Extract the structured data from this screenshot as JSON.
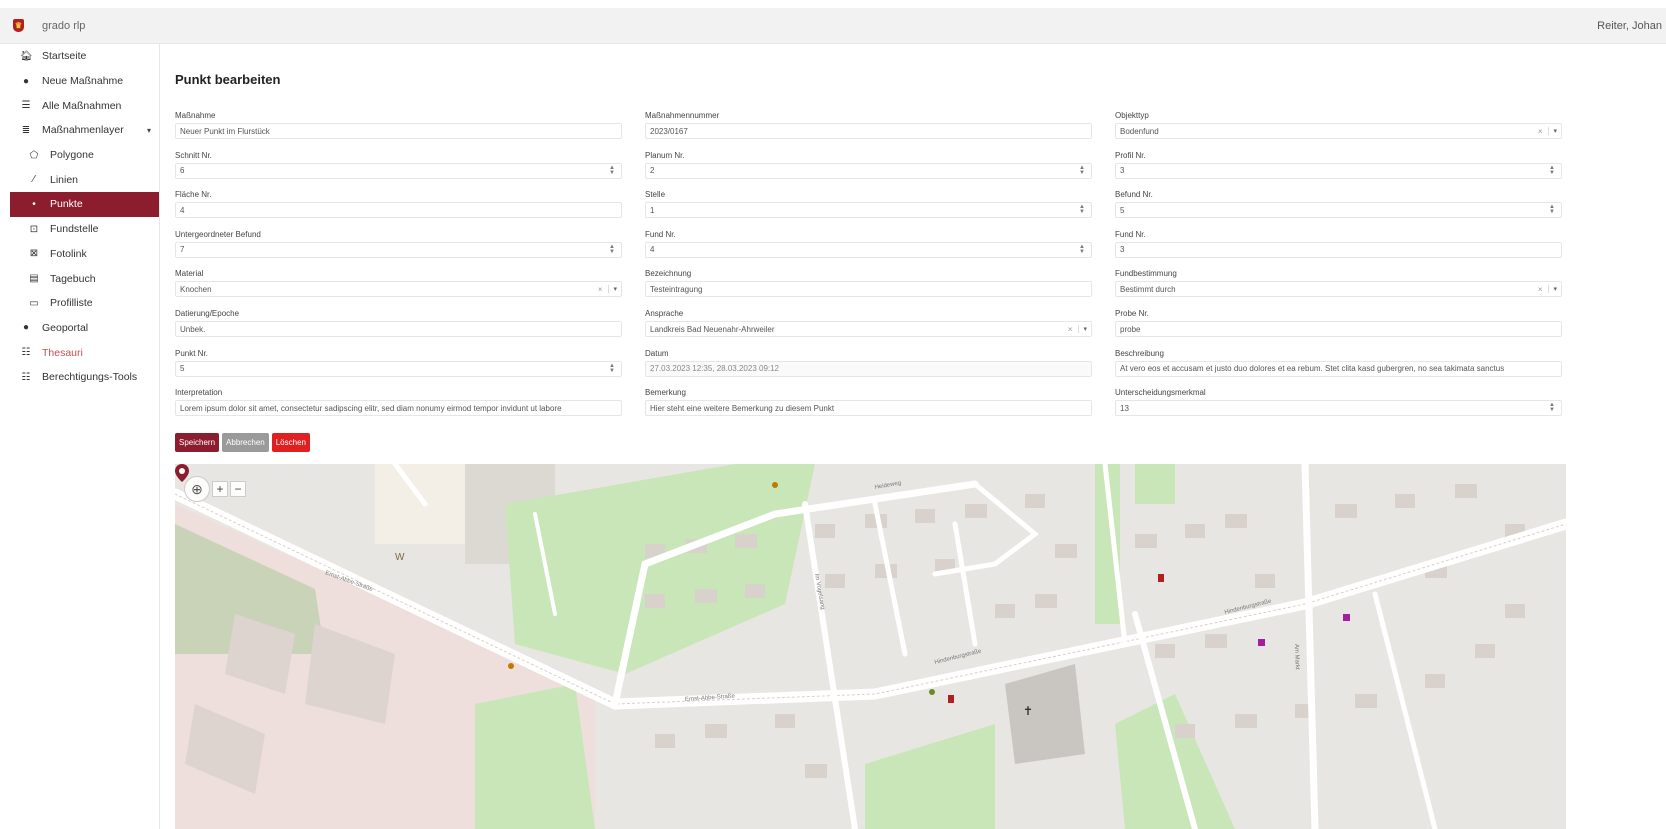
{
  "app": {
    "brand": "grado rlp",
    "user": "Reiter, Johan"
  },
  "nav": [
    {
      "label": "Startseite",
      "icon": "home-icon",
      "glyph": "🏠︎"
    },
    {
      "label": "Neue Maßnahme",
      "icon": "plus-circle-icon",
      "glyph": "●"
    },
    {
      "label": "Alle Maßnahmen",
      "icon": "list-icon",
      "glyph": "☰"
    },
    {
      "label": "Maßnahmenlayer",
      "icon": "layers-icon",
      "glyph": "≣"
    },
    {
      "label": "Polygone",
      "icon": "polygon-icon",
      "glyph": "⬠"
    },
    {
      "label": "Linien",
      "icon": "line-icon",
      "glyph": "⁄"
    },
    {
      "label": "Punkte",
      "icon": "point-icon",
      "glyph": "•"
    },
    {
      "label": "Fundstelle",
      "icon": "marker-icon",
      "glyph": "⊡"
    },
    {
      "label": "Fotolink",
      "icon": "image-icon",
      "glyph": "⊠"
    },
    {
      "label": "Tagebuch",
      "icon": "book-icon",
      "glyph": "▤"
    },
    {
      "label": "Profilliste",
      "icon": "folder-icon",
      "glyph": "▭"
    },
    {
      "label": "Geoportal",
      "icon": "globe-icon",
      "glyph": "●"
    },
    {
      "label": "Thesauri",
      "icon": "list-icon",
      "glyph": "☷"
    },
    {
      "label": "Berechtigungs-Tools",
      "icon": "tools-icon",
      "glyph": "☷"
    }
  ],
  "page": {
    "title": "Punkt bearbeiten",
    "buttons": {
      "save": "Speichern",
      "cancel": "Abbrechen",
      "delete": "Löschen"
    }
  },
  "fields": {
    "col1": [
      {
        "label": "Maßnahme",
        "value": "Neuer Punkt im Flurstück",
        "kind": "text"
      },
      {
        "label": "Schnitt Nr.",
        "value": "6",
        "kind": "number"
      },
      {
        "label": "Fläche Nr.",
        "value": "4",
        "kind": "text"
      },
      {
        "label": "Untergeordneter Befund",
        "value": "7",
        "kind": "number"
      },
      {
        "label": "Material",
        "value": "Knochen",
        "kind": "select"
      },
      {
        "label": "Datierung/Epoche",
        "value": "Unbek.",
        "kind": "text"
      },
      {
        "label": "Punkt Nr.",
        "value": "5",
        "kind": "number"
      },
      {
        "label": "Interpretation",
        "value": "Lorem ipsum dolor sit amet, consectetur sadipscing elitr, sed diam nonumy eirmod tempor invidunt ut labore",
        "kind": "text"
      }
    ],
    "col2": [
      {
        "label": "Maßnahmennummer",
        "value": "2023/0167",
        "kind": "text"
      },
      {
        "label": "Planum Nr.",
        "value": "2",
        "kind": "number"
      },
      {
        "label": "Stelle",
        "value": "1",
        "kind": "number"
      },
      {
        "label": "Fund Nr.",
        "value": "4",
        "kind": "number"
      },
      {
        "label": "Bezeichnung",
        "value": "Testeintragung",
        "kind": "text"
      },
      {
        "label": "Ansprache",
        "value": "Landkreis Bad Neuenahr-Ahrweiler",
        "kind": "select"
      },
      {
        "label": "Datum",
        "value": "27.03.2023 12:35, 28.03.2023 09:12",
        "kind": "readonly"
      },
      {
        "label": "Bemerkung",
        "value": "Hier steht eine weitere Bemerkung zu diesem Punkt",
        "kind": "text"
      }
    ],
    "col3": [
      {
        "label": "Objekttyp",
        "value": "Bodenfund",
        "kind": "select"
      },
      {
        "label": "Profil Nr.",
        "value": "3",
        "kind": "number"
      },
      {
        "label": "Befund Nr.",
        "value": "5",
        "kind": "number"
      },
      {
        "label": "Fund Nr.",
        "value": "3",
        "kind": "text"
      },
      {
        "label": "Fundbestimmung",
        "value": "Bestimmt durch",
        "kind": "select"
      },
      {
        "label": "Probe Nr.",
        "value": "probe",
        "kind": "text"
      },
      {
        "label": "Beschreibung",
        "value": "At vero eos et accusam et justo duo dolores et ea rebum. Stet clita kasd gubergren, no sea takimata sanctus",
        "kind": "text"
      },
      {
        "label": "Unterscheidungsmerkmal",
        "value": "13",
        "kind": "number"
      }
    ]
  },
  "map": {
    "streets": [
      "Ernst-Abbe-Straße",
      "Hindenburgstraße",
      "Heideweg",
      "Im Vogelsang",
      "Am Markt"
    ],
    "colors": {
      "background": "#e8e6e2",
      "park": "#c8e6b8",
      "residential": "#e0dfdc",
      "school": "#f2efe9",
      "road": "#ffffff",
      "marker": "#8c1d2e"
    }
  }
}
